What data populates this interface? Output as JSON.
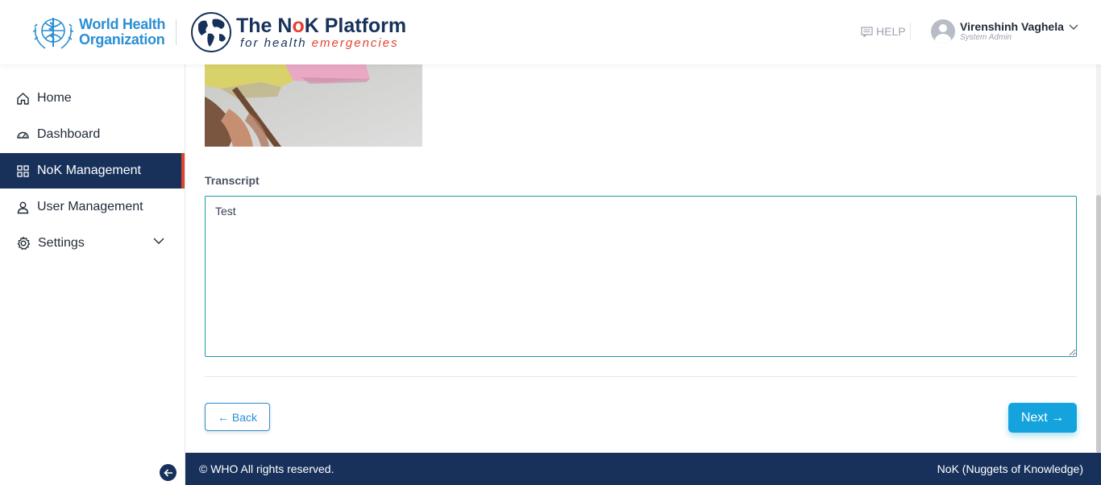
{
  "header": {
    "who_logo_line1": "World Health",
    "who_logo_line2": "Organization",
    "platform_title_prefix": "The N",
    "platform_title_o": "o",
    "platform_title_suffix": "K Platform",
    "platform_sub_prefix": "for health ",
    "platform_sub_suffix": "emergencies",
    "help_label": "HELP",
    "user_name": "Virenshinh Vaghela",
    "user_role": "System Admin"
  },
  "sidebar": {
    "items": [
      {
        "label": "Home",
        "icon": "home-icon"
      },
      {
        "label": "Dashboard",
        "icon": "dashboard-icon"
      },
      {
        "label": "NoK Management",
        "icon": "grid-icon",
        "active": true
      },
      {
        "label": "User Management",
        "icon": "user-icon"
      },
      {
        "label": "Settings",
        "icon": "gear-icon"
      }
    ]
  },
  "main": {
    "transcript_label": "Transcript",
    "transcript_value": "Test",
    "back_label": "← Back",
    "next_label": "Next →"
  },
  "footer": {
    "left": "© WHO All rights reserved.",
    "right": "NoK (Nuggets of Knowledge)"
  },
  "colors": {
    "navy": "#18315b",
    "accent_red": "#e2432f",
    "primary_blue": "#14a3dd",
    "who_blue": "#2a8fd4"
  }
}
